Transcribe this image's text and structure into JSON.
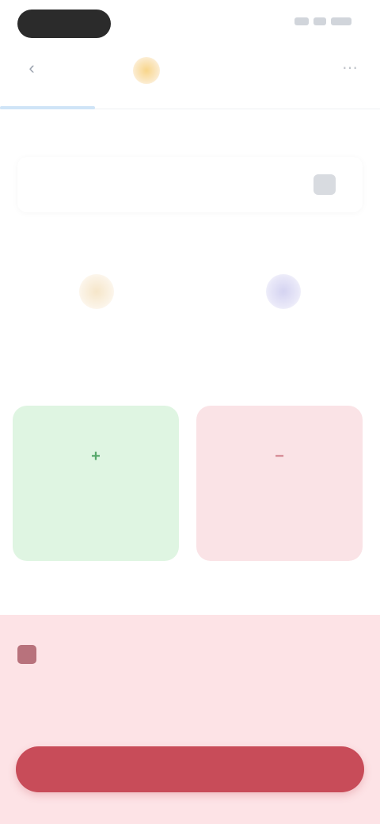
{
  "status_bar": {
    "time": ""
  },
  "header": {
    "title": "",
    "back_icon": "chevron-left-icon",
    "menu_icon": "more-icon",
    "accent": "#f8d58a"
  },
  "tabs": [
    {
      "label": ""
    }
  ],
  "section_title": "",
  "select": {
    "label": "",
    "icon": "select-icon"
  },
  "cards": [
    {
      "icon": "circle-icon",
      "color": "#f6e6c9",
      "label": "",
      "sub": ""
    },
    {
      "icon": "circle-icon",
      "color": "#d4d3f1",
      "label": "",
      "sub": ""
    }
  ],
  "actions": [
    {
      "icon": "plus-icon",
      "glyph": "+",
      "label": "",
      "color": "#dff5e2"
    },
    {
      "icon": "minus-icon",
      "glyph": "−",
      "label": "",
      "color": "#fae3e6"
    }
  ],
  "alert": {
    "title": "",
    "close": "",
    "line1": "",
    "line2": "",
    "button_label": "",
    "button_color": "#c84c59"
  }
}
